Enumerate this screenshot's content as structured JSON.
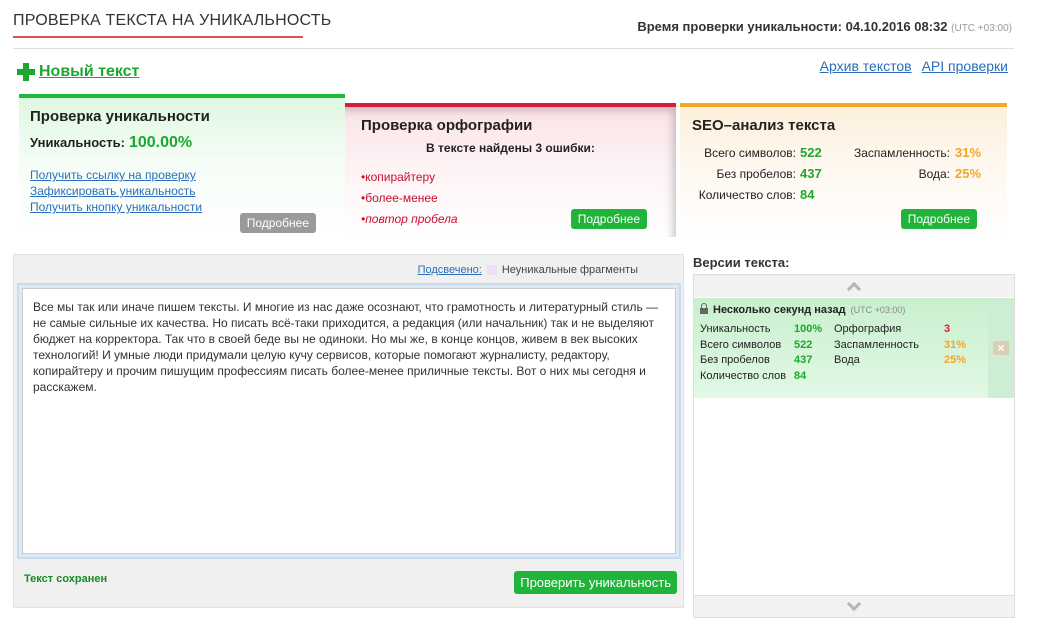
{
  "header": {
    "title": "ПРОВЕРКА ТЕКСТА НА УНИКАЛЬНОСТЬ",
    "check_time_label": "Время проверки уникальности: 04.10.2016 08:32",
    "check_time_tz": "(UTC +03:00)"
  },
  "toolbar": {
    "new_text": "Новый текст",
    "archive_link": "Архив текстов",
    "api_link": "API проверки"
  },
  "uniqueness_card": {
    "title": "Проверка уникальности",
    "label": "Уникальность:",
    "value": "100.00%",
    "links": [
      "Получить ссылку на проверку",
      "Зафиксировать уникальность",
      "Получить кнопку уникальности"
    ],
    "more_button": "Подробнее"
  },
  "spelling_card": {
    "title": "Проверка орфографии",
    "found_text": "В тексте найдены 3 ошибки:",
    "errors": [
      "копирайтеру",
      "более-менее",
      "повтор пробела"
    ],
    "more_button": "Подробнее"
  },
  "seo_card": {
    "title": "SEO–анализ текста",
    "total_chars_label": "Всего символов:",
    "total_chars": "522",
    "no_spaces_label": "Без пробелов:",
    "no_spaces": "437",
    "words_label": "Количество слов:",
    "words": "84",
    "spam_label": "Заспамленность:",
    "spam": "31%",
    "water_label": "Вода:",
    "water": "25%",
    "more_button": "Подробнее"
  },
  "editor": {
    "highlight_label": "Подсвечено:",
    "highlight_legend": "Неуникальные фрагменты",
    "text": "Все мы так или иначе пишем тексты. И многие из нас даже осознают, что грамотность и литературный стиль — не самые сильные их качества. Но писать всё-таки приходится, а редакция (или начальник) так и не выделяют бюджет на корректора. Так что в своей беде вы не одиноки. Но мы же, в конце концов, живем в век высоких технологий! И умные люди придумали целую кучу сервисов, которые помогают журналисту, редактору, копирайтеру и прочим пишущим профессиям писать более-менее приличные тексты. Вот о них мы сегодня  и расскажем.",
    "saved_status": "Текст сохранен",
    "check_button": "Проверить уникальность"
  },
  "versions": {
    "title": "Версии текста:",
    "item": {
      "time": "Несколько секунд назад",
      "tz": "(UTC +03:00)",
      "uniq_label": "Уникальность",
      "uniq": "100%",
      "total_label": "Всего символов",
      "total": "522",
      "no_spaces_label": "Без пробелов",
      "no_spaces": "437",
      "words_label": "Количество слов",
      "words": "84",
      "spell_label": "Орфография",
      "spell": "3",
      "spam_label": "Заспамленность",
      "spam": "31%",
      "water_label": "Вода",
      "water": "25%"
    }
  },
  "colors": {
    "accent_green": "#1ca72e",
    "accent_red": "#d81d3b",
    "accent_orange": "#f5a623",
    "link_blue": "#2a6ebb"
  }
}
